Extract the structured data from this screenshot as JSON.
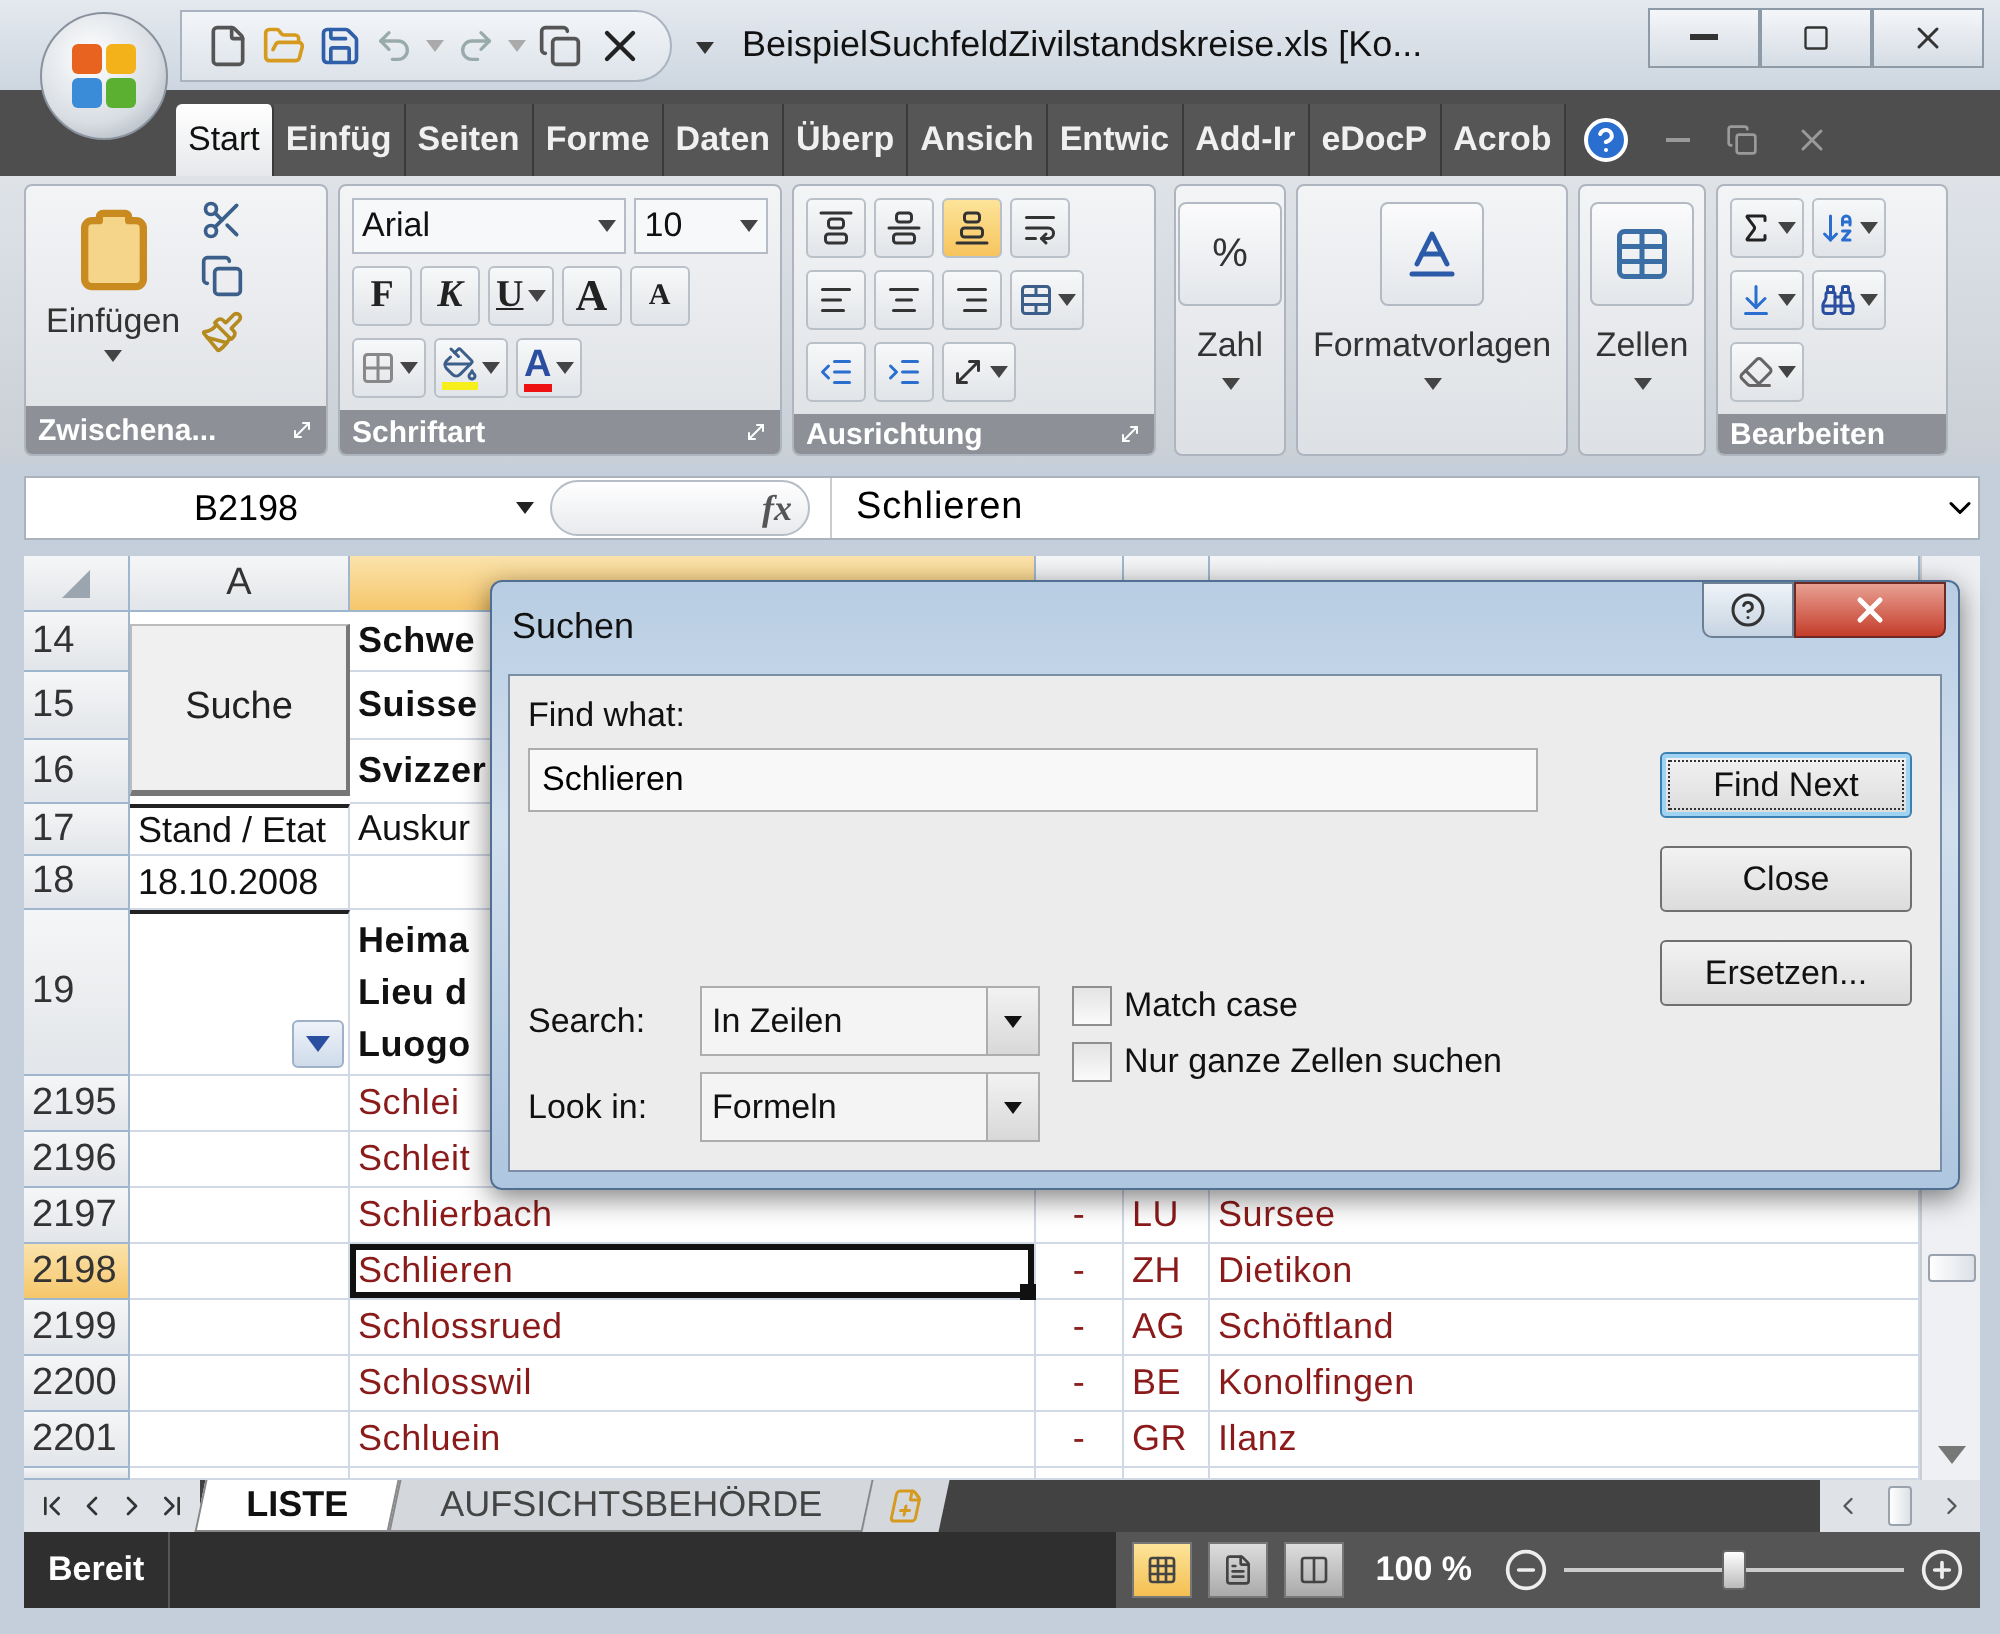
{
  "window": {
    "title": "BeispielSuchfeldZivilstandskreise.xls  [Ko..."
  },
  "ribbon_tabs": [
    {
      "label": "Start",
      "selected": true
    },
    {
      "label": "Einfüg",
      "selected": false
    },
    {
      "label": "Seiten",
      "selected": false
    },
    {
      "label": "Forme",
      "selected": false
    },
    {
      "label": "Daten",
      "selected": false
    },
    {
      "label": "Überp",
      "selected": false
    },
    {
      "label": "Ansich",
      "selected": false
    },
    {
      "label": "Entwic",
      "selected": false
    },
    {
      "label": "Add-Ir",
      "selected": false
    },
    {
      "label": "eDocP",
      "selected": false
    },
    {
      "label": "Acrob",
      "selected": false
    }
  ],
  "ribbon": {
    "clipboard": {
      "paste_label": "Einfügen",
      "label": "Zwischena..."
    },
    "font": {
      "name": "Arial",
      "size": "10",
      "bold": "F",
      "italic": "K",
      "underline": "U",
      "grow": "A",
      "shrink": "A",
      "color_letter": "A",
      "label": "Schriftart"
    },
    "alignment": {
      "label": "Ausrichtung",
      "vertical": [
        {
          "selected": false
        },
        {
          "selected": false
        },
        {
          "selected": true
        }
      ]
    },
    "collapsed_groups": [
      {
        "kind": "number",
        "symbol": "%",
        "label": "Zahl"
      },
      {
        "kind": "styles",
        "label": "Formatvorlagen"
      },
      {
        "kind": "cells",
        "label": "Zellen"
      }
    ],
    "editing": {
      "label": "Bearbeiten"
    }
  },
  "formula_bar": {
    "name_box": "B2198",
    "fx": "fx",
    "value": "Schlieren"
  },
  "sheet": {
    "columns": [
      {
        "label": "A",
        "selected": false
      },
      {
        "selected": true
      },
      {
        "selected": false
      },
      {
        "selected": false
      },
      {
        "selected": false
      }
    ],
    "header_block": {
      "row_numbers": [
        "14",
        "15",
        "16",
        "17",
        "18",
        "19"
      ],
      "search_button": "Suche",
      "titles": [
        "Schwe",
        "Suisse",
        "Svizzer"
      ],
      "status_label": "Stand / Etat",
      "info": "Auskur",
      "date": "18.10.2008",
      "heading_lines": [
        "Heima",
        "Lieu d",
        "Luogo"
      ]
    },
    "rows": [
      {
        "number": "2195",
        "selected": false,
        "cells": [
          "Schlei"
        ]
      },
      {
        "number": "2196",
        "selected": false,
        "cells": [
          "Schleit"
        ]
      },
      {
        "number": "2197",
        "selected": false,
        "cells": [
          "Schlierbach",
          "-",
          "LU",
          "Sursee"
        ]
      },
      {
        "number": "2198",
        "selected": true,
        "cells": [
          "Schlieren",
          "-",
          "ZH",
          "Dietikon"
        ]
      },
      {
        "number": "2199",
        "selected": false,
        "cells": [
          "Schlossrued",
          "-",
          "AG",
          "Schöftland"
        ]
      },
      {
        "number": "2200",
        "selected": false,
        "cells": [
          "Schlosswil",
          "-",
          "BE",
          "Konolfingen"
        ]
      },
      {
        "number": "2201",
        "selected": false,
        "cells": [
          "Schluein",
          "-",
          "GR",
          "Ilanz"
        ]
      }
    ]
  },
  "dialog": {
    "title": "Suchen",
    "find_label": "Find what:",
    "find_value": "Schlieren",
    "search_label": "Search:",
    "search_value": "In Zeilen",
    "look_in_label": "Look in:",
    "look_in_value": "Formeln",
    "options": [
      {
        "label": "Match case",
        "checked": false
      },
      {
        "label": "Nur ganze Zellen suchen",
        "checked": false
      }
    ],
    "buttons": [
      {
        "label": "Find Next",
        "default": true
      },
      {
        "label": "Close",
        "default": false
      },
      {
        "label": "Ersetzen...",
        "default": false
      }
    ]
  },
  "sheet_tabs": [
    {
      "label": "LISTE",
      "selected": true
    },
    {
      "label": "AUFSICHTSBEHÖRDE",
      "selected": false
    }
  ],
  "status_bar": {
    "text": "Bereit",
    "view_buttons": [
      {
        "selected": true
      },
      {
        "selected": false
      },
      {
        "selected": false
      }
    ],
    "zoom": "100 %",
    "zoom_slider": {
      "level": 0.5
    }
  }
}
